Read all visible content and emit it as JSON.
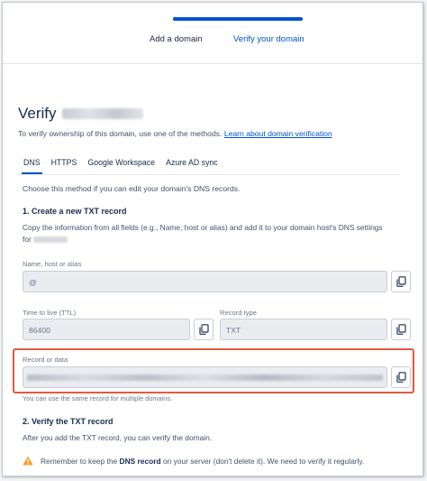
{
  "steps": {
    "step1_label": "Add a domain",
    "step2_label": "Verify your domain",
    "active_color": "#0052cc"
  },
  "header": {
    "title": "Verify"
  },
  "intro": {
    "text": "To verify ownership of this domain, use one of the methods.",
    "link_label": "Learn about domain verification"
  },
  "tabs": [
    {
      "label": "DNS",
      "active": true
    },
    {
      "label": "HTTPS",
      "active": false
    },
    {
      "label": "Google Workspace",
      "active": false
    },
    {
      "label": "Azure AD sync",
      "active": false
    }
  ],
  "dns": {
    "choose_text": "Choose this method if you can edit your domain's DNS records.",
    "step1_heading": "1. Create a new TXT record",
    "step1_text_line1": "Copy the information from all fields (e.g., Name, host or alias) and add it to your domain host's DNS settings",
    "step1_text_line2_prefix": "for",
    "name_label": "Name, host or alias",
    "name_value": "@",
    "ttl_label": "Time to live (TTL)",
    "ttl_value": "86400",
    "type_label": "Record type",
    "type_value": "TXT",
    "record_label": "Record or data",
    "hint": "You can use the same record for multiple domains.",
    "step2_heading": "2. Verify the TXT record",
    "step2_text": "After you add the TXT record, you can verify the domain.",
    "warning_before": "Remember to keep the",
    "warning_bold": "DNS record",
    "warning_after": "on your server (don't delete it). We need to verify it regularly.",
    "warning_icon": "warning-triangle-icon",
    "copy_icon": "copy-icon",
    "highlight_color": "#e05a3f"
  }
}
